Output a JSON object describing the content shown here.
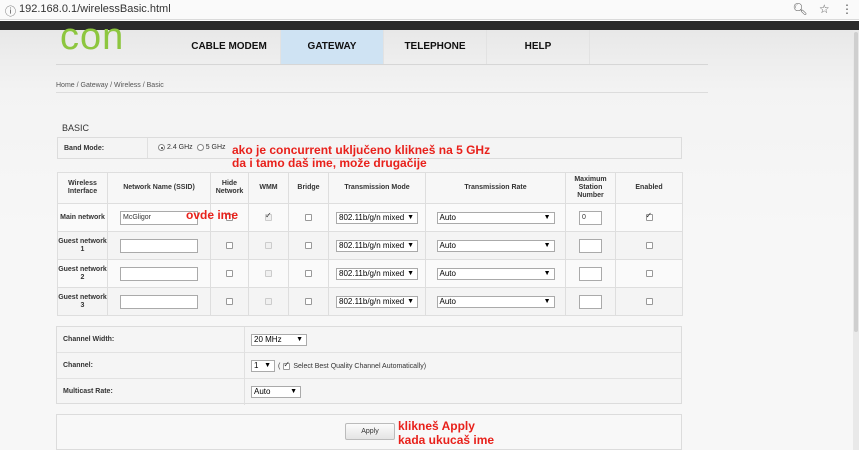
{
  "browser": {
    "info_icon": "info-icon",
    "url": "192.168.0.1/wirelessBasic.html",
    "zoom_icon": "zoom-icon",
    "star_icon": "star-icon",
    "menu_icon": "menu-icon"
  },
  "logo_text": "con",
  "nav": {
    "tabs": [
      {
        "label": "CABLE MODEM"
      },
      {
        "label": "GATEWAY"
      },
      {
        "label": "TELEPHONE"
      },
      {
        "label": "HELP"
      }
    ]
  },
  "breadcrumb": "Home / Gateway / Wireless / Basic",
  "section_title": "BASIC",
  "band": {
    "label": "Band Mode:",
    "opt1": "2.4 GHz",
    "opt2": "5 GHz"
  },
  "annotations": {
    "top_line1": "ako je concurrent uključeno klikneš na 5 GHz",
    "top_line2": "da i tamo daš ime, može drugačije",
    "ovde": "ovde ime",
    "apply_line1": "klikneš Apply",
    "apply_line2": "kada ukucaš ime"
  },
  "table": {
    "headers": {
      "iface": "Wireless Interface",
      "ssid": "Network Name (SSID)",
      "hide": "Hide Network",
      "wmm": "WMM",
      "bridge": "Bridge",
      "mode": "Transmission Mode",
      "rate": "Transmission Rate",
      "max": "Maximum Station Number",
      "enabled": "Enabled"
    },
    "rows": [
      {
        "label": "Main network",
        "ssid": "McGligor",
        "mode": "802.11b/g/n mixed",
        "rate": "Auto",
        "max": "0"
      },
      {
        "label": "Guest network 1",
        "ssid": "",
        "mode": "802.11b/g/n mixed",
        "rate": "Auto",
        "max": ""
      },
      {
        "label": "Guest network 2",
        "ssid": "",
        "mode": "802.11b/g/n mixed",
        "rate": "Auto",
        "max": ""
      },
      {
        "label": "Guest network 3",
        "ssid": "",
        "mode": "802.11b/g/n mixed",
        "rate": "Auto",
        "max": ""
      }
    ]
  },
  "channel": {
    "width_label": "Channel Width:",
    "width_value": "20 MHz",
    "channel_label": "Channel:",
    "channel_value": "1",
    "auto_text": "Select Best Quality Channel Automatically",
    "open_paren": "(",
    "close_paren": ")",
    "multicast_label": "Multicast Rate:",
    "multicast_value": "Auto"
  },
  "apply_label": "Apply",
  "arrow_glyph": "▼"
}
